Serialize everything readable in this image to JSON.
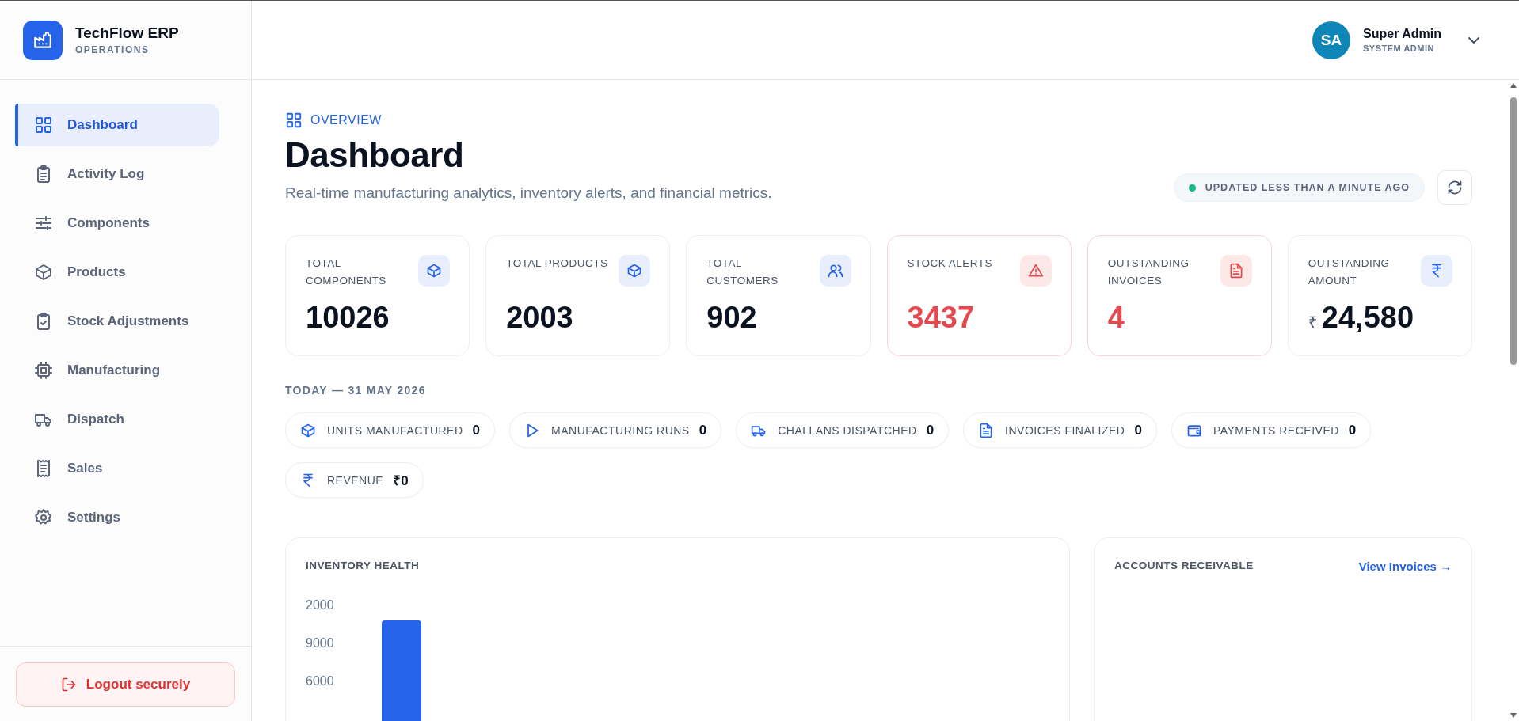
{
  "brand": {
    "name": "TechFlow ERP",
    "subtitle": "OPERATIONS"
  },
  "sidebar": {
    "items": [
      {
        "label": "Dashboard",
        "selected": true
      },
      {
        "label": "Activity Log",
        "selected": false
      },
      {
        "label": "Components",
        "selected": false
      },
      {
        "label": "Products",
        "selected": false
      },
      {
        "label": "Stock Adjustments",
        "selected": false
      },
      {
        "label": "Manufacturing",
        "selected": false
      },
      {
        "label": "Dispatch",
        "selected": false
      },
      {
        "label": "Sales",
        "selected": false
      },
      {
        "label": "Settings",
        "selected": false
      }
    ],
    "logout": "Logout securely"
  },
  "user": {
    "initials": "SA",
    "name": "Super Admin",
    "role": "SYSTEM ADMIN"
  },
  "page": {
    "eyebrow": "OVERVIEW",
    "title": "Dashboard",
    "subtitle": "Real-time manufacturing analytics, inventory alerts, and financial metrics.",
    "status": {
      "text": "UPDATED LESS THAN A MINUTE AGO",
      "live": true
    }
  },
  "stats": [
    {
      "label": "TOTAL COMPONENTS",
      "value": "10026",
      "alert": false
    },
    {
      "label": "TOTAL PRODUCTS",
      "value": "2003",
      "alert": false
    },
    {
      "label": "TOTAL CUSTOMERS",
      "value": "902",
      "alert": false
    },
    {
      "label": "STOCK ALERTS",
      "value": "3437",
      "alert": true
    },
    {
      "label": "OUTSTANDING INVOICES",
      "value": "4",
      "alert": true
    },
    {
      "label": "OUTSTANDING AMOUNT",
      "prefix": "₹",
      "value": "24,580",
      "alert": false
    }
  ],
  "today": {
    "heading": "TODAY — 31 MAY 2026",
    "items": [
      {
        "label": "UNITS MANUFACTURED",
        "value": "0"
      },
      {
        "label": "MANUFACTURING RUNS",
        "value": "0"
      },
      {
        "label": "CHALLANS DISPATCHED",
        "value": "0"
      },
      {
        "label": "INVOICES FINALIZED",
        "value": "0"
      },
      {
        "label": "PAYMENTS RECEIVED",
        "value": "0"
      },
      {
        "label": "REVENUE",
        "value": "₹0"
      }
    ]
  },
  "inventory_health": {
    "title": "INVENTORY HEALTH",
    "axis_labels": [
      "2000",
      "9000",
      "6000"
    ]
  },
  "accounts_receivable": {
    "title": "ACCOUNTS RECEIVABLE",
    "link": "View Invoices →"
  }
}
